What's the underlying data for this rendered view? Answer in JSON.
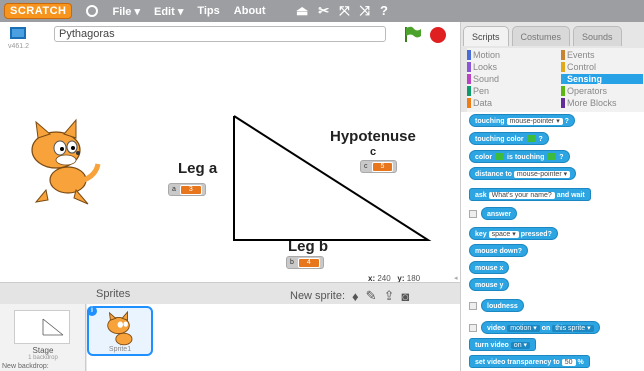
{
  "menubar": {
    "logo": "SCRATCH",
    "file": "File ▾",
    "edit": "Edit ▾",
    "tips": "Tips",
    "about": "About"
  },
  "stage_header": {
    "version": "v461.2",
    "project_name": "Pythagoras"
  },
  "stage": {
    "leg_a_label": "Leg a",
    "leg_b_label": "Leg b",
    "hypotenuse_label": "Hypotenuse",
    "c_label": "c",
    "monitors": [
      {
        "name": "a",
        "value": "3"
      },
      {
        "name": "b",
        "value": "4"
      },
      {
        "name": "c",
        "value": "5"
      }
    ]
  },
  "coords": {
    "x_label": "x:",
    "x": "240",
    "y_label": "y:",
    "y": "180"
  },
  "sprites": {
    "title": "Sprites",
    "new_sprite": "New sprite:",
    "stage_label": "Stage",
    "stage_sub": "1 backdrop",
    "new_backdrop": "New backdrop:",
    "sprite1": "Sprite1",
    "info": "i"
  },
  "tabs": [
    "Scripts",
    "Costumes",
    "Sounds"
  ],
  "categories": [
    {
      "label": "Motion",
      "color": "#4a6cd4"
    },
    {
      "label": "Looks",
      "color": "#8a55d7"
    },
    {
      "label": "Sound",
      "color": "#bb42c3"
    },
    {
      "label": "Pen",
      "color": "#0e9a6c"
    },
    {
      "label": "Data",
      "color": "#ee7d16"
    },
    {
      "label": "Events",
      "color": "#c88330"
    },
    {
      "label": "Control",
      "color": "#e1a91a"
    },
    {
      "label": "Sensing",
      "color": "#2ca5e2"
    },
    {
      "label": "Operators",
      "color": "#5cb712"
    },
    {
      "label": "More Blocks",
      "color": "#632d99"
    }
  ],
  "blocks": {
    "touching": "touching",
    "mouse_pointer": "mouse-pointer ▾",
    "q": "?",
    "touching_color": "touching color",
    "color": "color",
    "is_touching": "is touching",
    "distance_to": "distance to",
    "ask": "ask",
    "whats_your_name": "What's your name?",
    "and_wait": "and wait",
    "answer": "answer",
    "key": "key",
    "space": "space ▾",
    "pressed": "pressed?",
    "mouse_down": "mouse down?",
    "mouse_x": "mouse x",
    "mouse_y": "mouse y",
    "loudness": "loudness",
    "video": "video",
    "motion": "motion ▾",
    "on": "on",
    "this_sprite": "this sprite ▾",
    "turn_video": "turn video",
    "on_dd": "on ▾",
    "set_video_transparency": "set video transparency to",
    "fifty": "50",
    "percent": "%"
  }
}
